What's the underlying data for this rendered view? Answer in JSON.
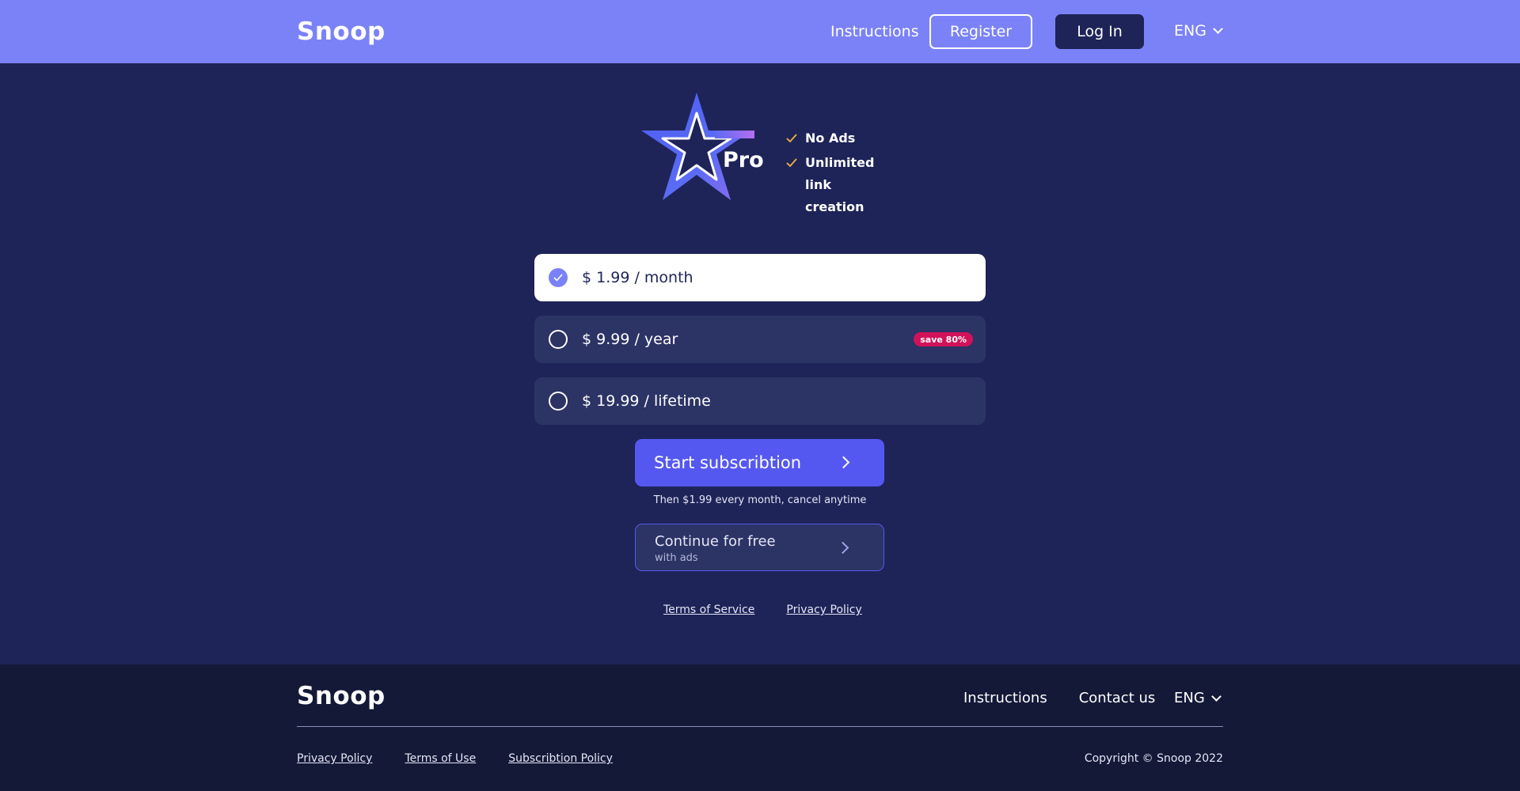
{
  "header": {
    "logo": "Snoop",
    "instructions": "Instructions",
    "register": "Register",
    "login": "Log In",
    "language": "ENG"
  },
  "hero": {
    "badge_label": "Pro",
    "features": [
      "No Ads",
      "Unlimited link creation"
    ]
  },
  "plans": [
    {
      "label": "$ 1.99 / month",
      "selected": true
    },
    {
      "label": "$ 9.99 / year",
      "badge": "save 80%"
    },
    {
      "label": "$ 19.99 / lifetime"
    }
  ],
  "cta": {
    "start": "Start subscribtion",
    "then_text": "Then $1.99 every month, cancel anytime",
    "free_main": "Continue for free",
    "free_sub": "with ads"
  },
  "legal": {
    "terms": "Terms of Service",
    "privacy": "Privacy Policy"
  },
  "footer": {
    "logo": "Snoop",
    "instructions": "Instructions",
    "contact": "Contact us",
    "language": "ENG",
    "privacy": "Privacy Policy",
    "terms": "Terms of Use",
    "subscription": "Subscribtion Policy",
    "copyright": "Copyright © Snoop 2022"
  },
  "colors": {
    "header_bg": "#7b82f7",
    "page_bg": "#1e2458",
    "footer_bg": "#141938",
    "accent": "#5558f0",
    "badge": "#d0125a",
    "check": "#f2b33d"
  },
  "icons": [
    "chevron-down-icon",
    "star-icon",
    "check-icon",
    "radio-checked-icon",
    "chevron-right-icon"
  ]
}
